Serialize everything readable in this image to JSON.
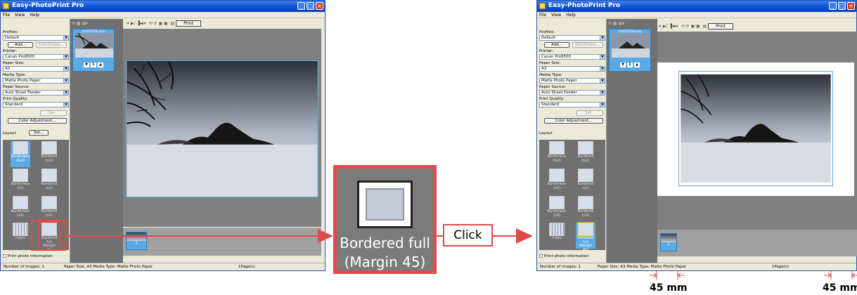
{
  "app": {
    "title": "Easy-PhotoPrint Pro",
    "menu": [
      "File",
      "View",
      "Help"
    ]
  },
  "left_panel": {
    "profiles_label": "Profiles:",
    "profiles_value": "Default",
    "add_button": "Add...",
    "edit_delete_button": "Edit/Delete...",
    "printer_label": "Printer:",
    "printer_value": "Canon Pro9500",
    "paper_size_label": "Paper Size:",
    "paper_size_value": "A3",
    "media_type_label": "Media Type:",
    "media_type_value": "Matte Photo Paper",
    "paper_source_label": "Paper Source:",
    "paper_source_value": "Auto Sheet Feeder",
    "print_quality_label": "Print Quality:",
    "print_quality_value": "Standard",
    "set_button": "Set...",
    "color_adjustment_button": "Color Adjustment...",
    "layout_label": "Layout",
    "layout_set_button": "Set...",
    "print_photo_info": "Print photo information"
  },
  "layouts": [
    {
      "line1": "Borderless",
      "line2": "(full)"
    },
    {
      "line1": "Bordered",
      "line2": "(full)"
    },
    {
      "line1": "Borderless",
      "line2": "(x2)"
    },
    {
      "line1": "Bordered",
      "line2": "(x2)"
    },
    {
      "line1": "Borderless",
      "line2": "(x4)"
    },
    {
      "line1": "Bordered",
      "line2": "(x4)"
    },
    {
      "line1": "Index",
      "line2": ""
    },
    {
      "line1": "Bordered full",
      "line2": "(Margin 45)"
    }
  ],
  "thumbnail": {
    "name": "010209048.bmp",
    "count": "1"
  },
  "toolbar": {
    "print_button": "Print"
  },
  "film_label": "1",
  "status": {
    "images": "Number of images: 1",
    "paper": "Paper Size: A3  Media Type: Matte Photo Paper",
    "pages": "1Page(s)"
  },
  "zoom": {
    "line1": "Bordered full",
    "line2": "(Margin 45)"
  },
  "click_label": "Click",
  "margin_left": "45 mm",
  "margin_right": "45 mm",
  "colors": {
    "accent": "#e14a4a",
    "selection": "#5aaae6",
    "titlebar": "#0a4fd0"
  }
}
